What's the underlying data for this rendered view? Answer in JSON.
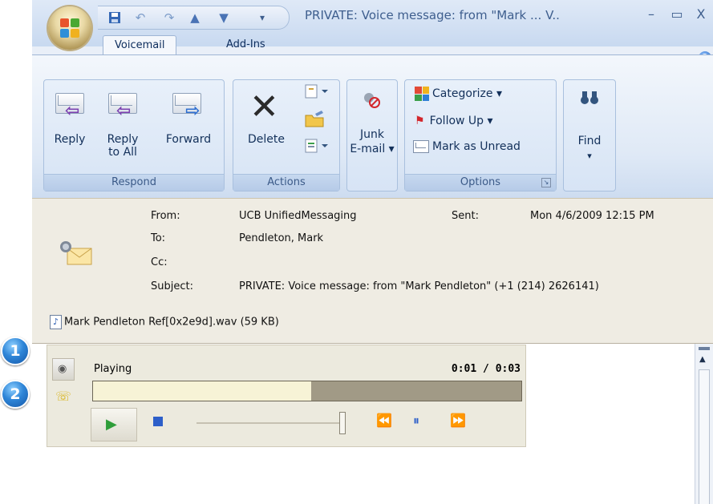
{
  "window": {
    "title": "PRIVATE: Voice message: from \"Mark ... V..",
    "minimize_symbol": "–",
    "maximize_symbol": "▭",
    "close_symbol": "X"
  },
  "quick_access": {
    "icons": [
      "save-icon",
      "undo-icon",
      "redo-icon",
      "up-arrow-icon",
      "down-arrow-icon",
      "customize-icon"
    ]
  },
  "tabs": [
    {
      "label": "Voicemail",
      "active": true
    },
    {
      "label": "Add-Ins",
      "active": false
    }
  ],
  "ribbon": {
    "respond": {
      "group_label": "Respond",
      "reply": "Reply",
      "reply_all_line1": "Reply",
      "reply_all_line2": "to All",
      "forward": "Forward"
    },
    "actions": {
      "group_label": "Actions",
      "delete": "Delete"
    },
    "junk": {
      "line1": "Junk",
      "line2": "E-mail ▾"
    },
    "options": {
      "group_label": "Options",
      "categorize": "Categorize ▾",
      "follow_up": "Follow Up ▾",
      "mark_unread": "Mark as Unread"
    },
    "find": {
      "label": "Find",
      "caret": "▾"
    }
  },
  "message": {
    "from_label": "From:",
    "from_value": "UCB UnifiedMessaging",
    "sent_label": "Sent:",
    "sent_value": "Mon 4/6/2009 12:15 PM",
    "to_label": "To:",
    "to_value": "Pendleton, Mark",
    "cc_label": "Cc:",
    "cc_value": "",
    "subject_label": "Subject:",
    "subject_value": "PRIVATE: Voice message: from \"Mark Pendleton\" (+1 (214) 2626141)",
    "attachment": "Mark Pendleton Ref[0x2e9d].wav (59 KB)"
  },
  "player": {
    "status": "Playing",
    "time": "0:01 / 0:03",
    "progress_fraction": 0.51,
    "volume_fraction": 1.0
  },
  "callouts": [
    "1",
    "2"
  ],
  "colors": {
    "accent": "#2f86d8",
    "progress_fill": "#f7f3d6",
    "progress_track": "#a19a86"
  }
}
